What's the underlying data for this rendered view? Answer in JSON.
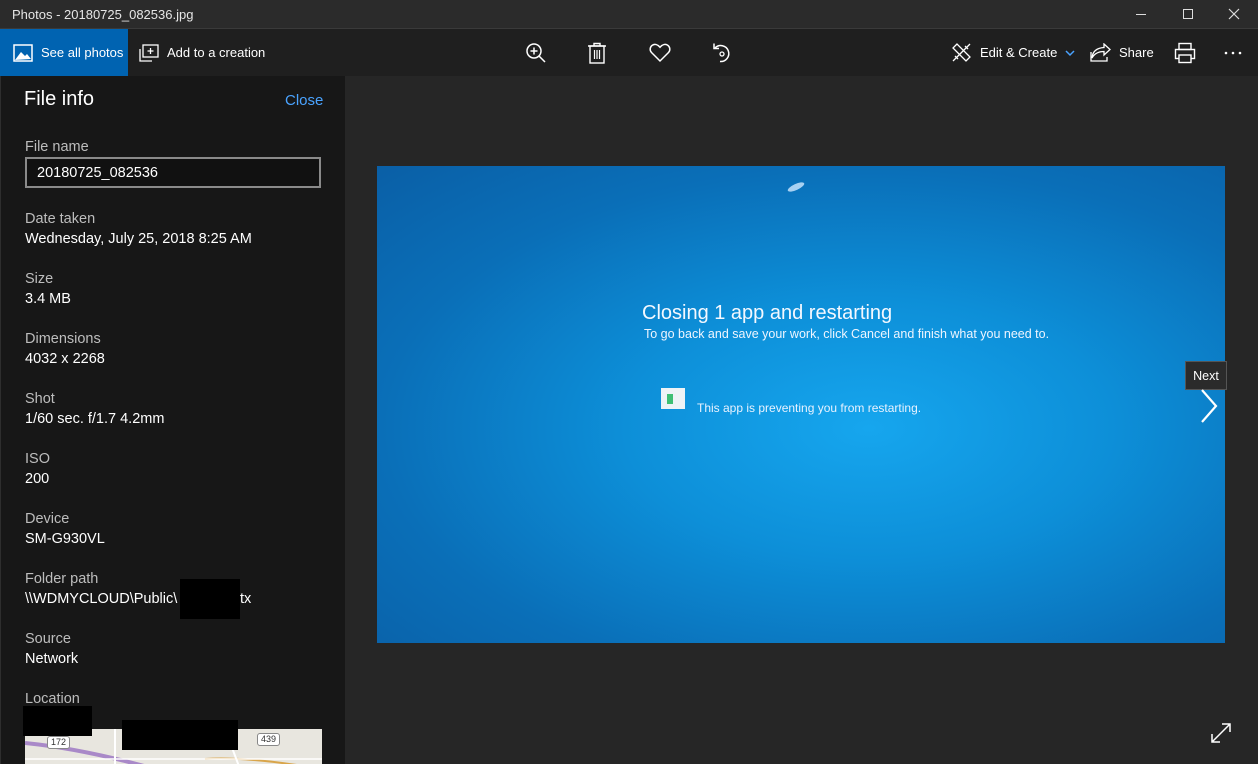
{
  "window": {
    "title": "Photos - 20180725_082536.jpg",
    "icons": [
      "minimize-icon",
      "maximize-icon",
      "close-icon"
    ]
  },
  "toolbar": {
    "see_all_label": "See all photos",
    "add_to_creation_label": "Add to a creation",
    "edit_create_label": "Edit & Create",
    "share_label": "Share",
    "accent": "#0063b1"
  },
  "file_info": {
    "title": "File info",
    "close_label": "Close",
    "fields": {
      "file_name": {
        "label": "File name",
        "value": "20180725_082536"
      },
      "date_taken": {
        "label": "Date taken",
        "value": "Wednesday, July 25, 2018 8:25 AM"
      },
      "size": {
        "label": "Size",
        "value": "3.4 MB"
      },
      "dimensions": {
        "label": "Dimensions",
        "value": "4032 x 2268"
      },
      "shot": {
        "label": "Shot",
        "value": "1/60 sec. f/1.7 4.2mm"
      },
      "iso": {
        "label": "ISO",
        "value": "200"
      },
      "device": {
        "label": "Device",
        "value": "SM-G930VL"
      },
      "folder_path": {
        "label": "Folder path",
        "value_start": "\\\\WDMYCLOUD\\Public\\",
        "value_end": "tx"
      },
      "source": {
        "label": "Source",
        "value": "Network"
      },
      "location": {
        "label": "Location"
      }
    },
    "map_labels": [
      "172",
      "439"
    ]
  },
  "photo": {
    "heading": "Closing 1 app and restarting",
    "subtext": "To go back and save your work, click Cancel and finish what you need to.",
    "app_text": "This app is preventing you from restarting."
  },
  "navigation": {
    "next_tooltip": "Next"
  }
}
